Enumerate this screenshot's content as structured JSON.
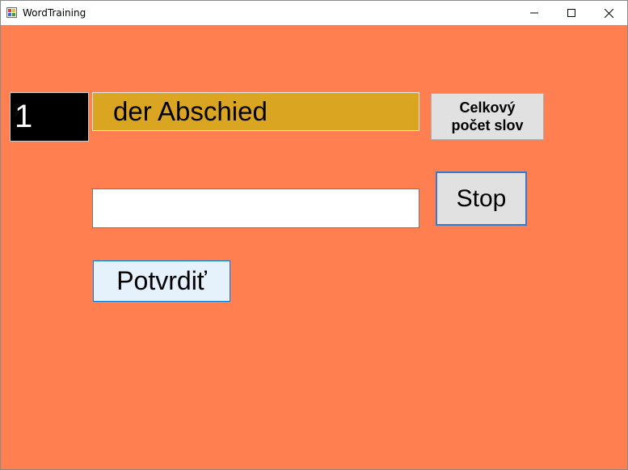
{
  "window": {
    "title": "WordTraining",
    "background_color": "#ff7f50",
    "controls": {
      "minimize_icon": "minimize-icon",
      "maximize_icon": "maximize-icon",
      "close_icon": "close-icon"
    }
  },
  "main": {
    "counter_value": "1",
    "word": "der Abschied",
    "word_box_color": "#daa520",
    "total_button_label": "Celkový\npočet slov",
    "stop_button_label": "Stop",
    "answer_input": {
      "value": "",
      "placeholder": ""
    },
    "confirm_button_label": "Potvrdiť"
  }
}
